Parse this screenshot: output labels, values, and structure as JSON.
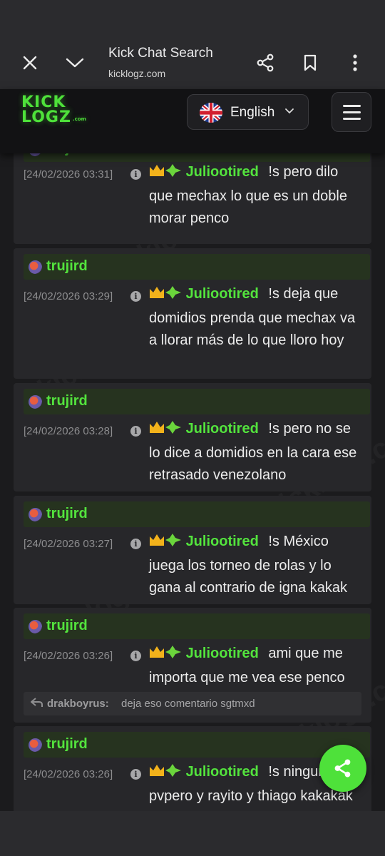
{
  "browser": {
    "title": "Kick Chat Search",
    "url": "kicklogz.com"
  },
  "site": {
    "logo_line1": "KICK",
    "logo_line2": "LOGZ",
    "logo_suffix": ".com",
    "language": "English",
    "watermark": "kicklogz.com"
  },
  "messages": [
    {
      "channel": "trujird",
      "timestamp": "[24/02/2026 03:31]",
      "user": "Juliootired",
      "text": "!s pero dilo que mechax lo que es un doble morar penco"
    },
    {
      "channel": "trujird",
      "timestamp": "[24/02/2026 03:29]",
      "user": "Juliootired",
      "text": "!s deja que domidios prenda que mechax va a llorar más de lo que lloro hoy"
    },
    {
      "channel": "trujird",
      "timestamp": "[24/02/2026 03:28]",
      "user": "Juliootired",
      "text": "!s pero no se lo dice a domidios en la cara ese retrasado venezolano"
    },
    {
      "channel": "trujird",
      "timestamp": "[24/02/2026 03:27]",
      "user": "Juliootired",
      "text": "!s México juega los torneo de rolas y lo gana al contrario de igna kakak"
    },
    {
      "channel": "trujird",
      "timestamp": "[24/02/2026 03:26]",
      "user": "Juliootired",
      "text": "ami que me importa que me vea ese penco",
      "reply_user": "drakboyrus:",
      "reply_text": "deja eso comentario sgtmxd"
    },
    {
      "channel": "trujird",
      "timestamp": "[24/02/2026 03:26]",
      "user": "Juliootired",
      "text": "!s ningun pvpero y rayito y thiago kakakak"
    }
  ],
  "colors": {
    "accent": "#4ee13a",
    "username": "#53e33d",
    "card": "#27272a",
    "channel_bar": "#26331f"
  }
}
